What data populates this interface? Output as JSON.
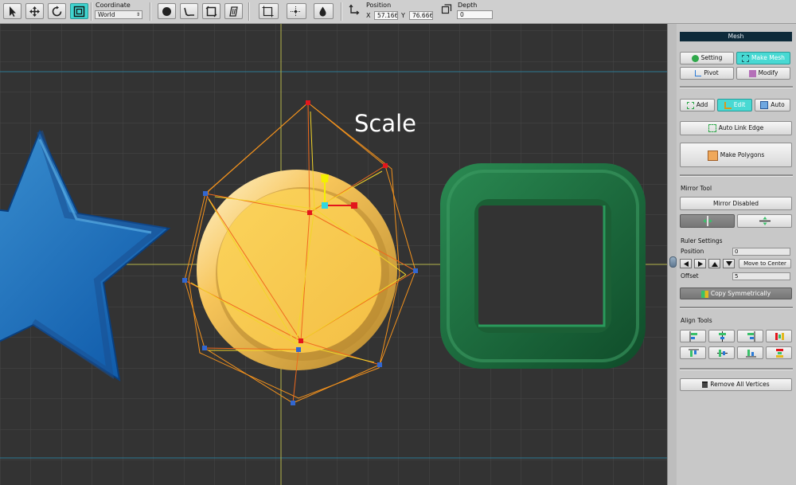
{
  "toolbar": {
    "tools": [
      {
        "name": "select",
        "icon": "arrow-cursor-icon",
        "active": false
      },
      {
        "name": "move",
        "icon": "move-icon",
        "active": false
      },
      {
        "name": "rotate",
        "icon": "rotate-icon",
        "active": false
      },
      {
        "name": "scale",
        "icon": "scale-icon",
        "active": true
      }
    ],
    "coordinate_label": "Coordinate",
    "coordinate_value": "World",
    "brush_tools": [
      "circle-brush-icon",
      "curve-brush-icon",
      "rect-brush-icon",
      "fill-brush-icon"
    ],
    "position_label": "Position",
    "x_label": "X",
    "x_value": "57.166",
    "y_label": "Y",
    "y_value": "76.666",
    "depth_label": "Depth",
    "depth_value": "0"
  },
  "viewport": {
    "overlay_text": "Scale",
    "background": "#333333",
    "grid_color": "#454545",
    "axis_color": "#b9b94a",
    "shapes": [
      "blue-star",
      "gold-coin",
      "green-rounded-square"
    ]
  },
  "panel": {
    "title": "Mesh",
    "mode_buttons": {
      "setting": "Setting",
      "make_mesh": "Make Mesh",
      "pivot": "Pivot",
      "modify": "Modify"
    },
    "edit_buttons": {
      "add": "Add",
      "edit": "Edit",
      "auto": "Auto"
    },
    "auto_link_edge": "Auto Link Edge",
    "make_polygons": "Make Polygons",
    "mirror_tool_label": "Mirror Tool",
    "mirror_button": "Mirror Disabled",
    "ruler_settings_label": "Ruler Settings",
    "position_label": "Position",
    "position_value": "0",
    "move_to_center": "Move to Center",
    "offset_label": "Offset",
    "offset_value": "5",
    "copy_symmetrically": "Copy Symmetrically",
    "align_tools_label": "Align Tools",
    "remove_all_vertices": "Remove All Vertices",
    "accent": "#48d9d3"
  }
}
